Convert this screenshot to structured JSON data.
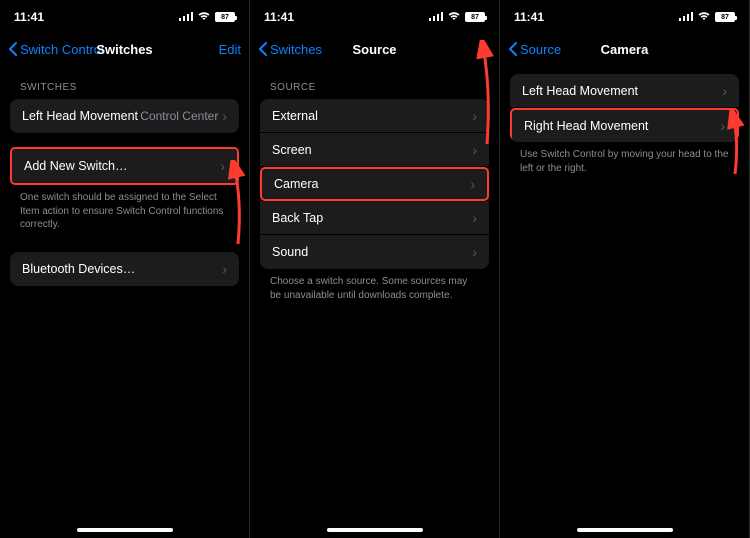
{
  "status": {
    "time": "11:41",
    "battery": "87"
  },
  "phone1": {
    "back": "Switch Control",
    "title": "Switches",
    "edit": "Edit",
    "section1": "SWITCHES",
    "row_left_head": "Left Head Movement",
    "row_left_head_detail": "Control Center",
    "row_add_new": "Add New Switch…",
    "footer1": "One switch should be assigned to the Select Item action to ensure Switch Control functions correctly.",
    "row_bluetooth": "Bluetooth Devices…"
  },
  "phone2": {
    "back": "Switches",
    "title": "Source",
    "section1": "SOURCE",
    "rows": {
      "external": "External",
      "screen": "Screen",
      "camera": "Camera",
      "back_tap": "Back Tap",
      "sound": "Sound"
    },
    "footer1": "Choose a switch source. Some sources may be unavailable until downloads complete."
  },
  "phone3": {
    "back": "Source",
    "title": "Camera",
    "row_left_head": "Left Head Movement",
    "row_right_head": "Right Head Movement",
    "footer1": "Use Switch Control by moving your head to the left or the right."
  }
}
